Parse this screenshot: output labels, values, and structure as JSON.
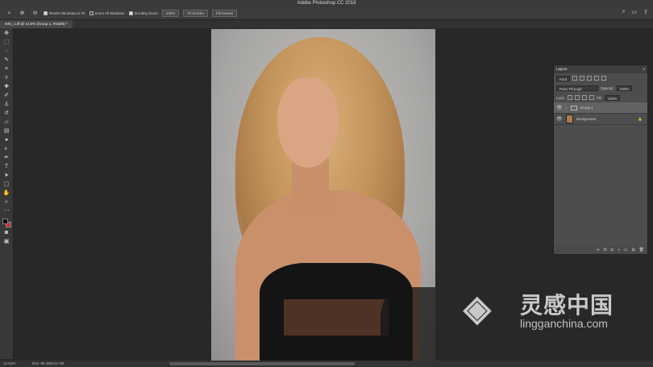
{
  "window": {
    "title": "Adobe Photoshop CC 2018"
  },
  "options_bar": {
    "resize_windows": "Resize Windows to Fit",
    "zoom_all": "Zoom All Windows",
    "scrubby_zoom": "Scrubby Zoom",
    "zoom_value": "100%",
    "fit_screen": "Fit Screen",
    "fill_screen": "Fill Screen"
  },
  "document_tab": {
    "label": "IMG_1.tif @ 14.6% (Group 1, RGB/8) *"
  },
  "toolbar": {
    "tools": [
      "move-icon",
      "marquee-icon",
      "lasso-icon",
      "quick-select-icon",
      "crop-icon",
      "eyedropper-icon",
      "healing-icon",
      "brush-icon",
      "stamp-icon",
      "history-brush-icon",
      "eraser-icon",
      "gradient-icon",
      "blur-icon",
      "dodge-icon",
      "pen-icon",
      "type-icon",
      "path-select-icon",
      "shape-icon",
      "hand-icon",
      "zoom-icon",
      "more-icon"
    ],
    "foreground_color": "#000000",
    "background_color": "#d12a2a"
  },
  "layers_panel": {
    "title": "Layers",
    "filter_kind": "Kind",
    "blend_mode": "Pass Through",
    "opacity_label": "Opacity:",
    "opacity_value": "100%",
    "lock_label": "Lock:",
    "fill_label": "Fill:",
    "fill_value": "100%",
    "layers": [
      {
        "name": "Group 1",
        "type": "group",
        "selected": true
      },
      {
        "name": "Background",
        "type": "image",
        "selected": false
      }
    ]
  },
  "status_bar": {
    "zoom": "14.61%",
    "doc": "Doc: 86.1M/212.1M"
  },
  "watermark": {
    "chinese": "灵感中国",
    "url": "lingganchina.com"
  }
}
